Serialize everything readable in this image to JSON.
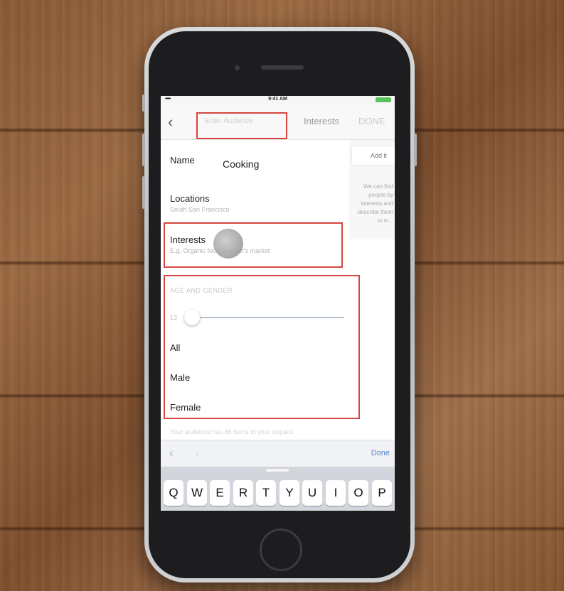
{
  "status_bar": {
    "signal": "•••••",
    "time": "9:41 AM"
  },
  "nav": {
    "back_icon": "chevron-left",
    "input_placeholder": "Enter Audience",
    "title": "Interests",
    "done": "DONE"
  },
  "form": {
    "name_label": "Name",
    "name_value": "Cooking",
    "locations_label": "Locations",
    "locations_value": "South San Francisco",
    "interests_label": "Interests",
    "interests_placeholder": "E.g. Organic food, Farmer's market",
    "add_button": "Add it",
    "side_note": "We can find people by interests and describe them to m...",
    "age_gender_heading": "AGE AND GENDER",
    "age_min": "13",
    "gender_options": [
      "All",
      "Male",
      "Female"
    ],
    "footnote": "Your audience has 86 items to your request"
  },
  "toolbar": {
    "prev_icon": "chevron-left",
    "next_icon": "chevron-right",
    "done": "Done"
  },
  "keyboard": {
    "keys": [
      "Q",
      "W",
      "E",
      "R",
      "T",
      "Y",
      "U",
      "I",
      "O",
      "P"
    ]
  },
  "colors": {
    "highlight": "#d6453f",
    "accent": "#5b86c9"
  }
}
